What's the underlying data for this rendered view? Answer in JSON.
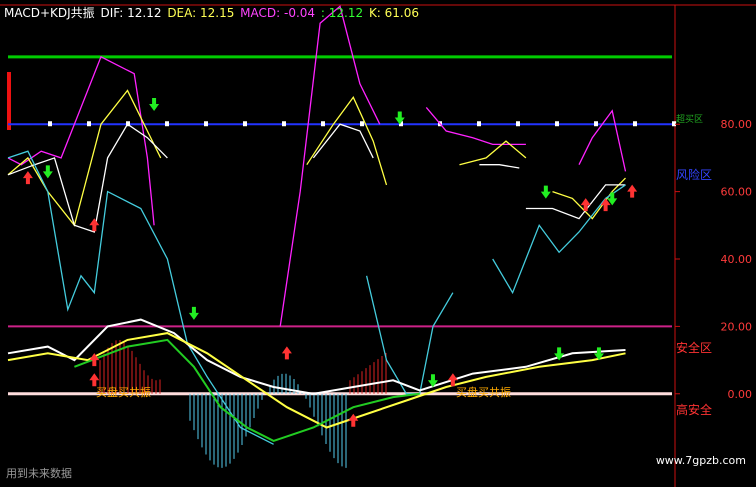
{
  "header": {
    "name": "MACD+KDJ共振",
    "dif": "DIF: 12.12",
    "dea": "DEA: 12.15",
    "macd": "MACD: -0.04",
    "extra": ": 12.12",
    "k": "K: 61.06"
  },
  "zone_labels": {
    "risk": "风险区",
    "safe": "安全区",
    "high_safe": "高安全",
    "left_text1": "买盘买共振",
    "left_text2": "买盘买共振",
    "top_small": "超买区"
  },
  "footer": "用到未来数据",
  "watermark": "www.7gpzb.com",
  "chart_data": {
    "type": "line",
    "yticks": [
      "80.00",
      "60.00",
      "40.00",
      "20.00",
      "0.00"
    ],
    "ylim": [
      -25,
      105
    ],
    "xlim": [
      0,
      100
    ],
    "reference_lines": [
      {
        "name": "green",
        "value": 100,
        "color": "#00cc00"
      },
      {
        "name": "blue",
        "value": 80,
        "color": "#2233ff"
      },
      {
        "name": "magenta",
        "value": 20,
        "color": "#cc2288"
      },
      {
        "name": "baseline",
        "value": 0,
        "color": "#ffdddd"
      }
    ],
    "series": [
      {
        "color": "#ff22ff",
        "segments": [
          [
            [
              0,
              70
            ],
            [
              2,
              68
            ],
            [
              5,
              72
            ],
            [
              8,
              70
            ],
            [
              14,
              100
            ],
            [
              19,
              95
            ],
            [
              21,
              70
            ],
            [
              22,
              50
            ]
          ],
          [
            [
              41,
              20
            ],
            [
              44,
              60
            ],
            [
              47,
              110
            ],
            [
              50,
              115
            ],
            [
              53,
              92
            ],
            [
              56,
              80
            ]
          ],
          [
            [
              63,
              85
            ],
            [
              66,
              78
            ],
            [
              70,
              76
            ],
            [
              73,
              74
            ],
            [
              78,
              74
            ]
          ],
          [
            [
              86,
              68
            ],
            [
              88,
              76
            ],
            [
              91,
              84
            ],
            [
              93,
              66
            ]
          ]
        ]
      },
      {
        "color": "#ffff44",
        "segments": [
          [
            [
              0,
              65
            ],
            [
              3,
              70
            ],
            [
              6,
              60
            ],
            [
              10,
              50
            ],
            [
              14,
              80
            ],
            [
              18,
              90
            ],
            [
              21,
              78
            ],
            [
              23,
              70
            ]
          ],
          [
            [
              45,
              68
            ],
            [
              49,
              80
            ],
            [
              52,
              88
            ],
            [
              55,
              75
            ],
            [
              57,
              62
            ]
          ],
          [
            [
              68,
              68
            ],
            [
              72,
              70
            ],
            [
              75,
              75
            ],
            [
              78,
              70
            ]
          ],
          [
            [
              82,
              60
            ],
            [
              85,
              58
            ],
            [
              88,
              52
            ],
            [
              91,
              60
            ],
            [
              93,
              64
            ]
          ]
        ]
      },
      {
        "color": "#ffffff",
        "segments": [
          [
            [
              0,
              65
            ],
            [
              4,
              68
            ],
            [
              7,
              70
            ],
            [
              10,
              50
            ],
            [
              13,
              48
            ],
            [
              15,
              70
            ],
            [
              18,
              80
            ],
            [
              21,
              76
            ],
            [
              24,
              70
            ]
          ],
          [
            [
              46,
              70
            ],
            [
              50,
              80
            ],
            [
              53,
              78
            ],
            [
              55,
              70
            ]
          ],
          [
            [
              71,
              68
            ],
            [
              74,
              68
            ],
            [
              77,
              67
            ]
          ],
          [
            [
              78,
              55
            ],
            [
              82,
              55
            ],
            [
              86,
              52
            ],
            [
              90,
              62
            ],
            [
              93,
              62
            ]
          ]
        ]
      },
      {
        "color": "#44ccdd",
        "segments": [
          [
            [
              0,
              70
            ],
            [
              3,
              72
            ],
            [
              6,
              60
            ],
            [
              9,
              25
            ],
            [
              11,
              35
            ],
            [
              13,
              30
            ],
            [
              15,
              60
            ],
            [
              20,
              55
            ],
            [
              24,
              40
            ],
            [
              27,
              15
            ],
            [
              30,
              5
            ],
            [
              35,
              -10
            ],
            [
              40,
              -15
            ]
          ],
          [
            [
              54,
              35
            ],
            [
              57,
              10
            ],
            [
              60,
              0
            ],
            [
              62,
              0
            ],
            [
              64,
              20
            ],
            [
              67,
              30
            ]
          ],
          [
            [
              73,
              40
            ],
            [
              76,
              30
            ],
            [
              80,
              50
            ],
            [
              83,
              42
            ],
            [
              86,
              48
            ],
            [
              90,
              58
            ],
            [
              93,
              62
            ]
          ]
        ]
      }
    ]
  }
}
